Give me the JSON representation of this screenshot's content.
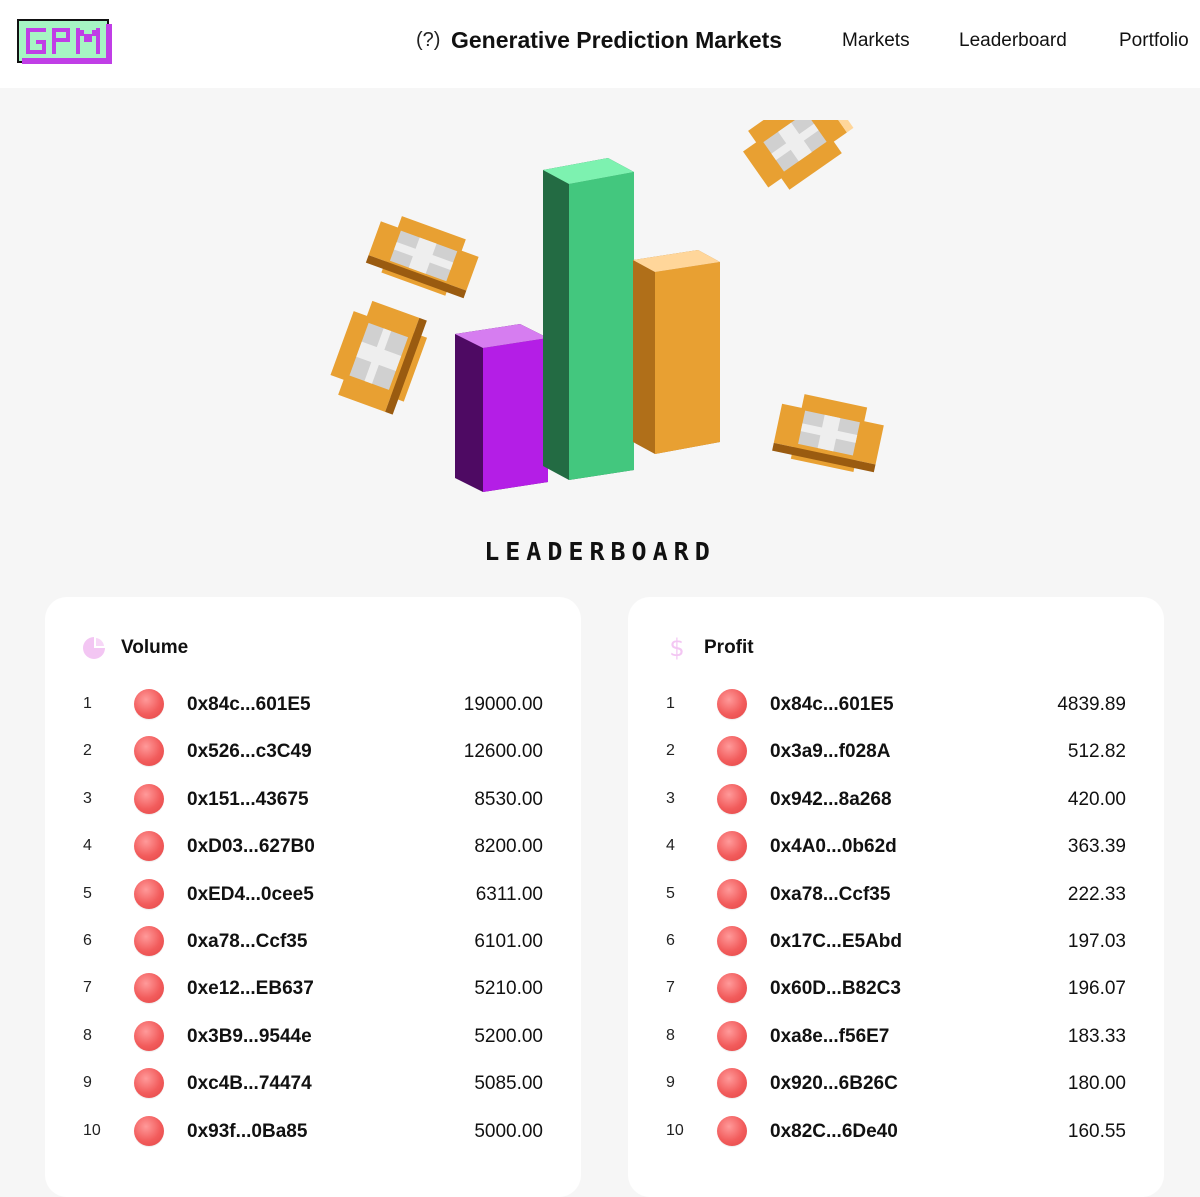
{
  "header": {
    "logo_text": "GPM",
    "help": "(?)",
    "title": "Generative Prediction Markets",
    "nav": [
      "Markets",
      "Leaderboard",
      "Portfolio"
    ]
  },
  "page": {
    "title": "LEADERBOARD"
  },
  "volume": {
    "title": "Volume",
    "icon": "pie-chart-icon",
    "rows": [
      {
        "rank": "1",
        "address": "0x84c...601E5",
        "value": "19000.00"
      },
      {
        "rank": "2",
        "address": "0x526...c3C49",
        "value": "12600.00"
      },
      {
        "rank": "3",
        "address": "0x151...43675",
        "value": "8530.00"
      },
      {
        "rank": "4",
        "address": "0xD03...627B0",
        "value": "8200.00"
      },
      {
        "rank": "5",
        "address": "0xED4...0cee5",
        "value": "6311.00"
      },
      {
        "rank": "6",
        "address": "0xa78...Ccf35",
        "value": "6101.00"
      },
      {
        "rank": "7",
        "address": "0xe12...EB637",
        "value": "5210.00"
      },
      {
        "rank": "8",
        "address": "0x3B9...9544e",
        "value": "5200.00"
      },
      {
        "rank": "9",
        "address": "0xc4B...74474",
        "value": "5085.00"
      },
      {
        "rank": "10",
        "address": "0x93f...0Ba85",
        "value": "5000.00"
      }
    ]
  },
  "profit": {
    "title": "Profit",
    "icon": "dollar-icon",
    "rows": [
      {
        "rank": "1",
        "address": "0x84c...601E5",
        "value": "4839.89"
      },
      {
        "rank": "2",
        "address": "0x3a9...f028A",
        "value": "512.82"
      },
      {
        "rank": "3",
        "address": "0x942...8a268",
        "value": "420.00"
      },
      {
        "rank": "4",
        "address": "0x4A0...0b62d",
        "value": "363.39"
      },
      {
        "rank": "5",
        "address": "0xa78...Ccf35",
        "value": "222.33"
      },
      {
        "rank": "6",
        "address": "0x17C...E5Abd",
        "value": "197.03"
      },
      {
        "rank": "7",
        "address": "0x60D...B82C3",
        "value": "196.07"
      },
      {
        "rank": "8",
        "address": "0xa8e...f56E7",
        "value": "183.33"
      },
      {
        "rank": "9",
        "address": "0x920...6B26C",
        "value": "180.00"
      },
      {
        "rank": "10",
        "address": "0x82C...6De40",
        "value": "160.55"
      }
    ]
  },
  "colors": {
    "accent_green": "#43c77e",
    "accent_purple": "#b41ee6",
    "accent_orange": "#e8a032",
    "avatar": "#f25c5c",
    "icon_pink": "#f3c6f3"
  }
}
